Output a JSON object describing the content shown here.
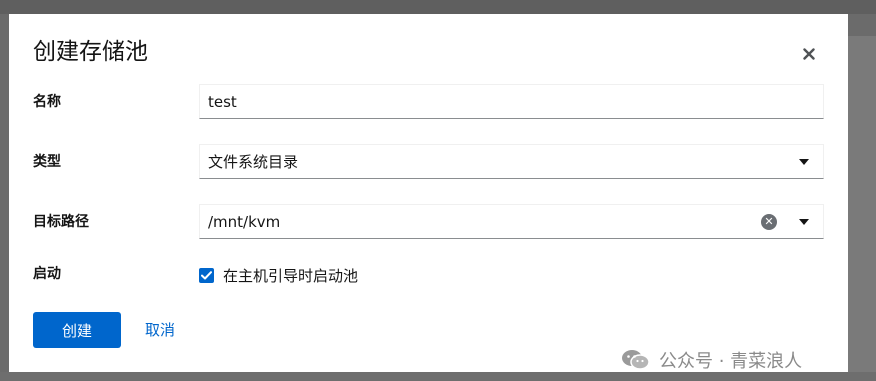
{
  "dialog": {
    "title": "创建存储池",
    "close_glyph": "×"
  },
  "form": {
    "name": {
      "label": "名称",
      "value": "test"
    },
    "type": {
      "label": "类型",
      "value": "文件系统目录"
    },
    "target_path": {
      "label": "目标路径",
      "value": "/mnt/kvm"
    },
    "autostart": {
      "label": "启动",
      "checkbox_label": "在主机引导时启动池",
      "checked": true
    }
  },
  "actions": {
    "create_label": "创建",
    "cancel_label": "取消"
  },
  "watermark": {
    "text": "公众号 · 青菜浪人"
  },
  "colors": {
    "primary": "#0066cc",
    "text": "#151515",
    "overlay": "#6b6b6b"
  },
  "icons": {
    "close": "close-icon",
    "dropdown": "caret-down-icon",
    "clear": "clear-circle-icon",
    "check": "checkmark-icon",
    "watermark_logo": "wechat-logo-icon"
  }
}
